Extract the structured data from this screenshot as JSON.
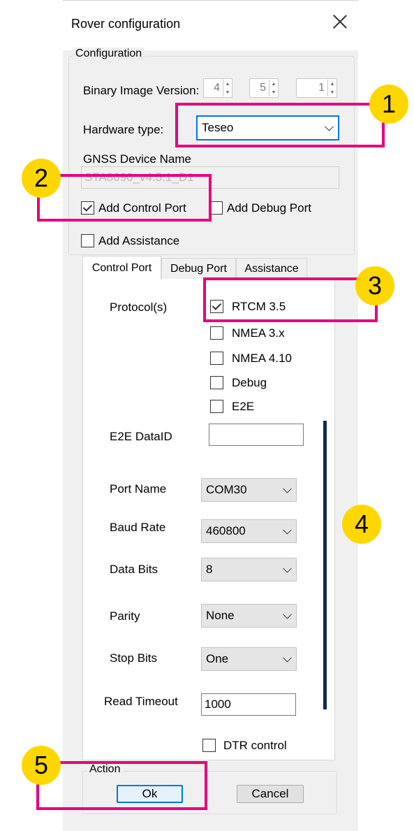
{
  "window": {
    "title": "Rover configuration"
  },
  "configuration": {
    "legend": "Configuration",
    "binary_image_version_label": "Binary Image Version:",
    "version_parts": [
      "4",
      "5",
      "1"
    ],
    "hardware_type_label": "Hardware type:",
    "hardware_type_value": "Teseo",
    "gnss_device_name_label": "GNSS Device Name",
    "gnss_device_name_value": "STA8090_v4.5.1_D1",
    "add_control_port": {
      "label": "Add Control Port",
      "checked": true
    },
    "add_debug_port": {
      "label": "Add Debug Port",
      "checked": false
    },
    "add_assistance": {
      "label": "Add Assistance",
      "checked": false
    }
  },
  "tabs": [
    {
      "label": "Control Port",
      "selected": true
    },
    {
      "label": "Debug Port",
      "selected": false
    },
    {
      "label": "Assistance",
      "selected": false
    }
  ],
  "control_port": {
    "protocols_label": "Protocol(s)",
    "protocols": [
      {
        "label": "RTCM 3.5",
        "checked": true
      },
      {
        "label": "NMEA 3.x",
        "checked": false
      },
      {
        "label": "NMEA 4.10",
        "checked": false
      },
      {
        "label": "Debug",
        "checked": false
      },
      {
        "label": "E2E",
        "checked": false
      }
    ],
    "e2e_dataid_label": "E2E DataID",
    "e2e_dataid_value": "",
    "port_name_label": "Port Name",
    "port_name_value": "COM30",
    "baud_rate_label": "Baud Rate",
    "baud_rate_value": "460800",
    "data_bits_label": "Data Bits",
    "data_bits_value": "8",
    "parity_label": "Parity",
    "parity_value": "None",
    "stop_bits_label": "Stop Bits",
    "stop_bits_value": "One",
    "read_timeout_label": "Read Timeout",
    "read_timeout_value": "1000",
    "dtr_control": {
      "label": "DTR control",
      "checked": false
    }
  },
  "action": {
    "legend": "Action",
    "ok_label": "Ok",
    "cancel_label": "Cancel"
  },
  "callouts": [
    "1",
    "2",
    "3",
    "4",
    "5"
  ],
  "colors": {
    "callout_border": "#e6007e",
    "callout_fill": "#ffd700",
    "accent": "#0078d7",
    "bar": "#14284b"
  }
}
